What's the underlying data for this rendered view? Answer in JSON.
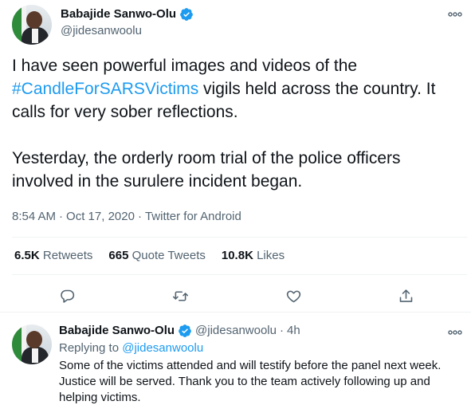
{
  "main_tweet": {
    "display_name": "Babajide Sanwo-Olu",
    "handle": "@jidesanwoolu",
    "more_icon": "more-horizontal-icon",
    "text_line1_before": "I have seen powerful images and videos of the ",
    "hashtag": "#CandleForSARSVictims",
    "text_line1_after": " vigils held across the country. It calls for very sober reflections.",
    "text_paragraph2": "Yesterday, the orderly room trial of the police officers involved in the surulere incident began.",
    "time": "8:54 AM",
    "date": "Oct 17, 2020",
    "source": "Twitter for Android",
    "separator": "·",
    "retweets_count": "6.5K",
    "retweets_label": "Retweets",
    "quote_count": "665",
    "quote_label": "Quote Tweets",
    "likes_count": "10.8K",
    "likes_label": "Likes"
  },
  "reply_tweet": {
    "display_name": "Babajide Sanwo-Olu",
    "handle": "@jidesanwoolu",
    "dot": "·",
    "time": "4h",
    "replying_prefix": "Replying to ",
    "replying_mention": "@jidesanwoolu",
    "text": "Some of the victims attended and will testify before the panel next week. Justice will be served. Thank you to the team actively following up and helping victims."
  },
  "colors": {
    "accent": "#1d9bf0",
    "secondary_text": "#536471",
    "divider": "#eff3f4"
  },
  "icons": [
    "verified-badge-icon",
    "reply-icon",
    "retweet-icon",
    "like-icon",
    "share-icon",
    "more-horizontal-icon"
  ]
}
